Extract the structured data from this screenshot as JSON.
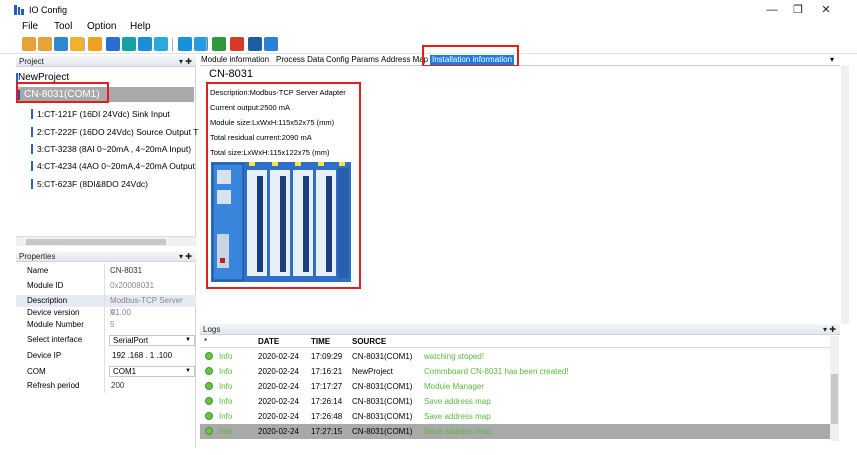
{
  "window": {
    "title": "IO Config",
    "controls": [
      "—",
      "❐",
      "✕"
    ]
  },
  "menu": [
    "File",
    "Tool",
    "Option",
    "Help"
  ],
  "toolbar": {
    "icons": [
      "folder-open-icon",
      "folder-icon",
      "save-icon",
      "connect-icon",
      "settings-icon",
      "search-icon",
      "refresh-icon",
      "stop-icon",
      "download-icon",
      "grid-icon",
      "monitor-icon",
      "export-icon",
      "delete-icon",
      "write-icon",
      "window-icon"
    ],
    "colors": [
      "#e8a23a",
      "#e8a23a",
      "#2a8bd0",
      "#f0b030",
      "#f0a020",
      "#2a6fd0",
      "#18a0a8",
      "#1a8fd6",
      "#2aa8e0",
      "#1a90d8",
      "#2a9be0",
      "#2c9a3a",
      "#d83a2a",
      "#1a5ea8",
      "#2a7fd8"
    ]
  },
  "project_panel": {
    "title": "Project",
    "pin": "▾ ✚",
    "root": "NewProject",
    "selected": "CN-8031(COM1)",
    "modules": [
      "1:CT-121F (16DI 24Vdc) Sink Input",
      "2:CT-222F (16DO 24Vdc) Source Output T",
      "3:CT-3238 (8AI 0~20mA , 4~20mA Input)",
      "4:CT-4234 (4AO 0~20mA,4~20mA Output",
      "5:CT-623F (8DI&8DO 24Vdc)"
    ]
  },
  "properties_panel": {
    "title": "Properties",
    "pin": "▾ ✚",
    "rows": [
      {
        "key": "Name",
        "value": "CN-8031"
      },
      {
        "key": "Module ID",
        "value": "0x20008031"
      },
      {
        "key": "Description",
        "value": "Modbus-TCP Server A..."
      },
      {
        "key": "Device version",
        "value": "V1.00"
      },
      {
        "key": "Module Number",
        "value": "5"
      },
      {
        "key": "Select interface",
        "value": "SerialPort"
      },
      {
        "key": "Device IP",
        "value": "192 .168 . 1 .100"
      },
      {
        "key": "COM",
        "value": "COM1"
      },
      {
        "key": "Refresh period",
        "value": "200"
      }
    ]
  },
  "tabs": {
    "items": [
      "Module information",
      "Process Data",
      "Config Params",
      "Address Map",
      "Installation information"
    ],
    "active": 4,
    "menu": "▾"
  },
  "installation": {
    "heading": "CN-8031",
    "description": "Description:Modbus-TCP Server Adapter",
    "current_output": "Current output:2500 mA",
    "module_size": "Module size:LxWxH:115x52x75 (mm)",
    "residual_current": "Total residual current:2090 mA",
    "total_size": "Total size:LxWxH:115x122x75 (mm)"
  },
  "logs": {
    "title": "Logs",
    "pin": "▾ ✚",
    "columns": [
      "*",
      "DATE",
      "TIME",
      "SOURCE"
    ],
    "rows": [
      {
        "level": "Info",
        "date": "2020-02-24",
        "time": "17:09:29",
        "source": "CN-8031(COM1)",
        "message": "watching stoped!"
      },
      {
        "level": "Info",
        "date": "2020-02-24",
        "time": "17:16:21",
        "source": "NewProject",
        "message": "Commboard CN-8031 has been created!"
      },
      {
        "level": "Info",
        "date": "2020-02-24",
        "time": "17:17:27",
        "source": "CN-8031(COM1)",
        "message": "Module Manager"
      },
      {
        "level": "Info",
        "date": "2020-02-24",
        "time": "17:26:14",
        "source": "CN-8031(COM1)",
        "message": "Save address map"
      },
      {
        "level": "Info",
        "date": "2020-02-24",
        "time": "17:26:48",
        "source": "CN-8031(COM1)",
        "message": "Save address map"
      },
      {
        "level": "Info",
        "date": "2020-02-24",
        "time": "17:27:15",
        "source": "CN-8031(COM1)",
        "message": "Save address map"
      }
    ],
    "selected_row": 5
  }
}
